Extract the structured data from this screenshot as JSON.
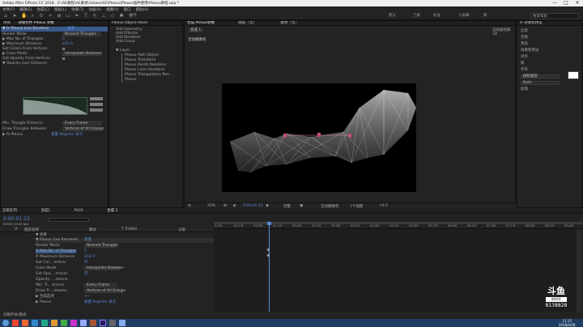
{
  "window": {
    "title": "Adobe After Effects CC 2018 - E:\\AE教程\\AE素材\\3d\\aes\\AE\\Plexus\\Plexus插件使用\\Plexus教程.aep *",
    "min": "—",
    "max": "□",
    "close": "✕"
  },
  "menu": [
    "文件(F)",
    "编辑(E)",
    "合成(C)",
    "图层(L)",
    "效果(T)",
    "动画(A)",
    "视图(V)",
    "窗口",
    "帮助(H)"
  ],
  "toolbar": {
    "snap": "对齐",
    "workspaces": [
      "默认",
      "了解",
      "标准",
      "小屏幕",
      "库"
    ],
    "search": "搜索帮助"
  },
  "effect_controls": {
    "tabs": [
      "项目",
      "效果控件 Plexus 参数"
    ],
    "rows": [
      {
        "txt": "▼ fx  Plexus       Line Renderer",
        "sel": true
      },
      {
        "txt": "      Render Mode",
        "val": "Nearest Triangles"
      },
      {
        "txt": "   ▶  Max No. of Triangles",
        "val": "5"
      },
      {
        "txt": "   ▶  Maximum Distance",
        "val": "222.0"
      },
      {
        "txt": "      Get Colors From Vertices",
        "chk": true
      },
      {
        "txt": "   ▶  Color Mode",
        "val": "Interpolate Between"
      },
      {
        "txt": "      Get Opacity From Vertices",
        "chk": true
      },
      {
        "txt": "   ▼  Opacity over Distance",
        "val": ""
      }
    ],
    "rows2": [
      {
        "txt": "      Min. Triangle Distance",
        "val": "Every Frame"
      },
      {
        "txt": "      Draw Triangles Between",
        "val": "Vertices of All Groups"
      },
      {
        "txt": "▶ fx  Plexus",
        "val": "重置  Register  关于"
      }
    ]
  },
  "layers": {
    "header": "Plexus Object Panel",
    "add": [
      "Add Geometry",
      "Add Effector",
      "Add Renderer",
      "Add Group"
    ],
    "tree_root": "▼ Layer",
    "tree": [
      "Plexus Path Object",
      "Plexus Transform",
      "Plexus Points Renderer",
      "Plexus Lines Renderer",
      "Plexus Triangulation Ren...",
      "Plexus"
    ]
  },
  "comp": {
    "tabs": [
      "合成 Plexus参数",
      "图层（无）",
      "素材（无）"
    ],
    "subtab": "合成 1",
    "renderer": "渲染器经典3D",
    "cam": "活动摄像机",
    "camview": "1个视...",
    "footer": [
      "25%",
      "0:00:01:15",
      "完整",
      "活动摄像机",
      "1个视图",
      "+0.0"
    ],
    "zoom": "25%",
    "time": "0:00:01:15",
    "quality": "完整",
    "views": "1个视图",
    "exposure": "+0.0"
  },
  "right": {
    "tabs": [
      "≡ 效果和预设"
    ],
    "items": [
      "信息",
      "音频",
      "预览",
      "效果和预设",
      "对齐",
      "库",
      "字符",
      "段落"
    ],
    "font": "微软雅黑",
    "style": "Bold"
  },
  "timeline": {
    "tabs": [
      "渲染队列",
      "合成1",
      "PL01",
      "合成 1",
      "Plexus参数"
    ],
    "timecode": "0:00:01:15",
    "fps": "00040 (25.00 fps)",
    "cols": [
      "#",
      "图层名称",
      "模式",
      "T TrkMat",
      "父级"
    ],
    "ruler": [
      "0:00s",
      "00:15f",
      "01:00f",
      "01:15f",
      "02:00f",
      "02:15f",
      "03:00f",
      "03:15f",
      "04:00f",
      "04:15f",
      "05:00f",
      "05:15f",
      "06:00f",
      "06:15f",
      "07:00f",
      "07:15f",
      "08:00f",
      "08:15f",
      "09:00f"
    ],
    "rows": [
      {
        "n": "",
        "t": "▼ 效果"
      },
      {
        "n": "",
        "t": "   ▼ Plexus    Line Renderer",
        "v": "重置"
      },
      {
        "n": "",
        "t": "      Render Mode",
        "v": "Nearest Triangles"
      },
      {
        "n": "",
        "t": "      ⏱ Max No. of Triangles",
        "v": "5",
        "hl": true
      },
      {
        "n": "",
        "t": "      ⏱ Maximum Distance",
        "v": "222.0"
      },
      {
        "n": "",
        "t": "      Get Col... ertices",
        "v": "开"
      },
      {
        "n": "",
        "t": "      Color Mode",
        "v": "Interpolate Between"
      },
      {
        "n": "",
        "t": "      Get Opa... ertices",
        "v": "开"
      },
      {
        "n": "",
        "t": "      Opacity ... stance",
        "v": ""
      },
      {
        "n": "",
        "t": "      Min. Tr... stance",
        "v": "Every Frame"
      },
      {
        "n": "",
        "t": "      Draw Tr... etween",
        "v": "Vertices of All Groups"
      },
      {
        "n": "",
        "t": "   ▶ 合成选项",
        "v": "+−"
      },
      {
        "n": "",
        "t": "▶ Plexus",
        "v": "重置  Register  关于"
      }
    ],
    "bottom": "切换开关/模式"
  },
  "watermark": {
    "logo": "斗鱼",
    "sub": "房间号",
    "id": "8138828"
  },
  "taskbar": {
    "time": "11:15",
    "date": "2018/4/28"
  }
}
